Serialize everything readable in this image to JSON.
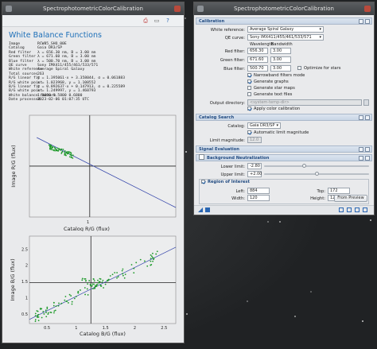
{
  "left_window": {
    "title": "SpectrophotometricColorCalibration",
    "heading": "White Balance Functions",
    "info_rows": [
      {
        "key": "Image",
        "value": "RCW85_SHO_00E"
      },
      {
        "key": "Catalog",
        "value": "Gaia DR3/SP"
      },
      {
        "key": "Red filter",
        "value": "λ = 656.30 nm, B = 3.00 nm"
      },
      {
        "key": "Green filter",
        "value": "λ = 671.60 nm, B = 3.00 nm"
      },
      {
        "key": "Blue filter",
        "value": "λ = 500.70 nm, B = 3.00 nm"
      },
      {
        "key": "QE curve",
        "value": "Sony IMX411/455/461/533/571"
      },
      {
        "key": "White reference",
        "value": "Average Spiral Galaxy"
      },
      {
        "key": "Total sources",
        "value": "263"
      },
      {
        "key": "R/G linear fit",
        "value": "y = 1.395061·x + 3.358044, σ = 0.061883"
      },
      {
        "key": "R/G white point",
        "value": "x = 1.023968, y = 1.100552"
      },
      {
        "key": "B/G linear fit",
        "value": "y = 0.892637·x + 0.147913, σ = 0.225589"
      },
      {
        "key": "B/G white point",
        "value": "x = 1.249997, y = 1.460793"
      },
      {
        "key": "White balance factors",
        "value": "1.0000 0.5800 0.6800"
      },
      {
        "key": "Date processed",
        "value": "2023-02-06 01:07:35 UTC"
      }
    ],
    "plot_top": {
      "ylabel": "Image R/G (flux)",
      "xlabel": "Catalog R/G (flux)",
      "tick_1": "1"
    },
    "plot_bottom": {
      "ylabel": "Image B/G (flux)",
      "xlabel": "Catalog B/G (flux)",
      "x_ticks": [
        "0.5",
        "1",
        "1.5",
        "2",
        "2.5"
      ],
      "y_ticks": [
        "0.5",
        "1",
        "1.5",
        "2",
        "2.5"
      ]
    }
  },
  "chart_data": [
    {
      "type": "scatter",
      "title": "",
      "xlabel": "Catalog R/G (flux)",
      "ylabel": "Image R/G (flux)",
      "x_tick_labels": [
        "1"
      ],
      "white_point": {
        "x": 1.023968,
        "y": 1.100552
      },
      "fit": {
        "slope": -1.395061,
        "intercept": 3.358044
      },
      "note": "dense cluster near x≈0.6, y≈1.4 trending down"
    },
    {
      "type": "scatter",
      "title": "",
      "xlabel": "Catalog B/G (flux)",
      "ylabel": "Image B/G (flux)",
      "x_tick_labels": [
        "0.5",
        "1",
        "1.5",
        "2",
        "2.5"
      ],
      "y_tick_labels": [
        "0.5",
        "1",
        "1.5",
        "2",
        "2.5"
      ],
      "xlim": [
        0.2,
        2.7
      ],
      "ylim": [
        0.2,
        2.9
      ],
      "white_point": {
        "x": 1.249997,
        "y": 1.460793
      },
      "fit": {
        "slope": 0.892637,
        "intercept": 0.147913
      }
    }
  ],
  "right_window": {
    "title": "SpectrophotometricColorCalibration",
    "calibration": {
      "header": "Calibration",
      "white_reference_label": "White reference:",
      "white_reference_value": "Average Spiral Galaxy",
      "qe_label": "QE curve:",
      "qe_value": "Sony IMX411/455/461/533/571",
      "col_wavelength": "Wavelength",
      "col_bandwidth": "Bandwidth",
      "red_label": "Red filter:",
      "red_wl": "656.30",
      "red_bw": "3.00",
      "green_label": "Green filter:",
      "green_wl": "671.60",
      "green_bw": "3.00",
      "blue_label": "Blue filter:",
      "blue_wl": "500.70",
      "blue_bw": "3.00",
      "optimize_label": "Optimize for stars",
      "narrowband_label": "Narrowband filters mode",
      "gen_graphs_label": "Generate graphs",
      "gen_star_maps_label": "Generate star maps",
      "gen_text_files_label": "Generate text files",
      "output_dir_label": "Output directory:",
      "output_dir_placeholder": "<system-temp-dir>",
      "apply_label": "Apply color calibration"
    },
    "catalog_search": {
      "header": "Catalog Search",
      "catalog_label": "Catalog:",
      "catalog_value": "Gaia DR3/SP",
      "auto_limit_label": "Automatic limit magnitude",
      "limit_label": "Limit magnitude:",
      "limit_value": "12.0"
    },
    "signal_evaluation": {
      "header": "Signal Evaluation"
    },
    "background": {
      "header": "Background Neutralization",
      "lower_label": "Lower limit:",
      "lower_value": "-2.80",
      "upper_label": "Upper limit:",
      "upper_value": "+2.00",
      "lower_pos": 0.38,
      "upper_pos": 0.5,
      "roi_header": "Region of Interest",
      "left_label": "Left:",
      "left_value": "884",
      "top_label": "Top:",
      "top_value": "172",
      "width_label": "Width:",
      "width_value": "120",
      "height_label": "Height:",
      "height_value": "120",
      "preview_button": "From Preview"
    }
  }
}
